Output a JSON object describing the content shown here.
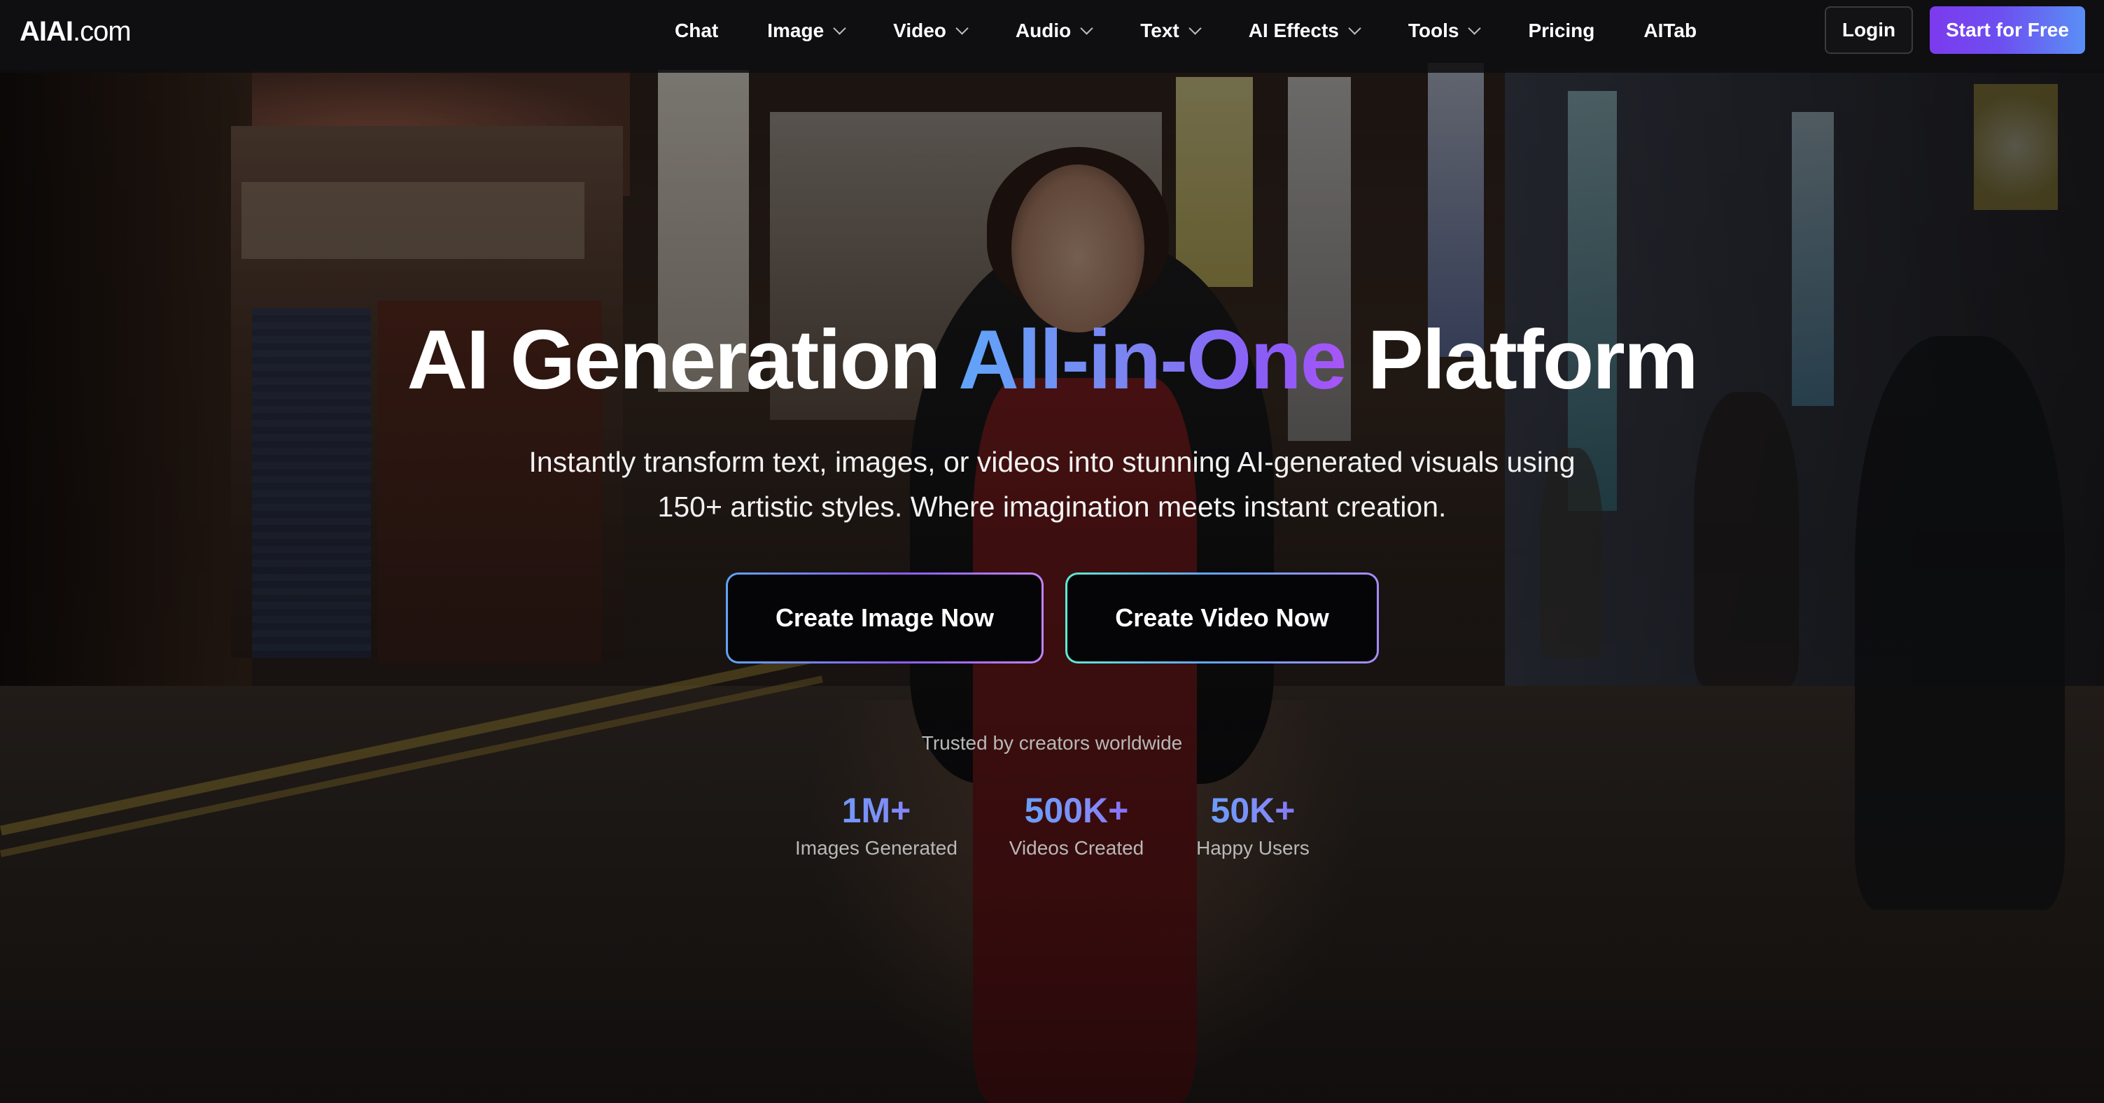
{
  "brand": {
    "logo_strong": "AIAI",
    "logo_light": ".com"
  },
  "nav": {
    "items": [
      {
        "label": "Chat",
        "has_dropdown": false
      },
      {
        "label": "Image",
        "has_dropdown": true
      },
      {
        "label": "Video",
        "has_dropdown": true
      },
      {
        "label": "Audio",
        "has_dropdown": true
      },
      {
        "label": "Text",
        "has_dropdown": true
      },
      {
        "label": "AI Effects",
        "has_dropdown": true
      },
      {
        "label": "Tools",
        "has_dropdown": true
      },
      {
        "label": "Pricing",
        "has_dropdown": false
      },
      {
        "label": "AITab",
        "has_dropdown": false
      }
    ],
    "login_label": "Login",
    "start_label": "Start for Free"
  },
  "hero": {
    "title_part1": "AI Generation ",
    "title_highlight": "All-in-One",
    "title_part2": " Platform",
    "subtitle_line1": "Instantly transform text, images, or videos into stunning AI-generated visuals using",
    "subtitle_line2": "150+ artistic styles. Where imagination meets instant creation.",
    "cta_image": "Create Image Now",
    "cta_video": "Create Video Now",
    "trusted": "Trusted by creators worldwide",
    "stats": [
      {
        "value": "1M+",
        "label": "Images Generated"
      },
      {
        "value": "500K+",
        "label": "Videos Created"
      },
      {
        "value": "50K+",
        "label": "Happy Users"
      }
    ]
  },
  "colors": {
    "accent_start": "#7c3aed",
    "accent_end": "#5a8ff5",
    "gradient_blue": "#60a5fa",
    "gradient_purple": "#8b5cf6"
  }
}
